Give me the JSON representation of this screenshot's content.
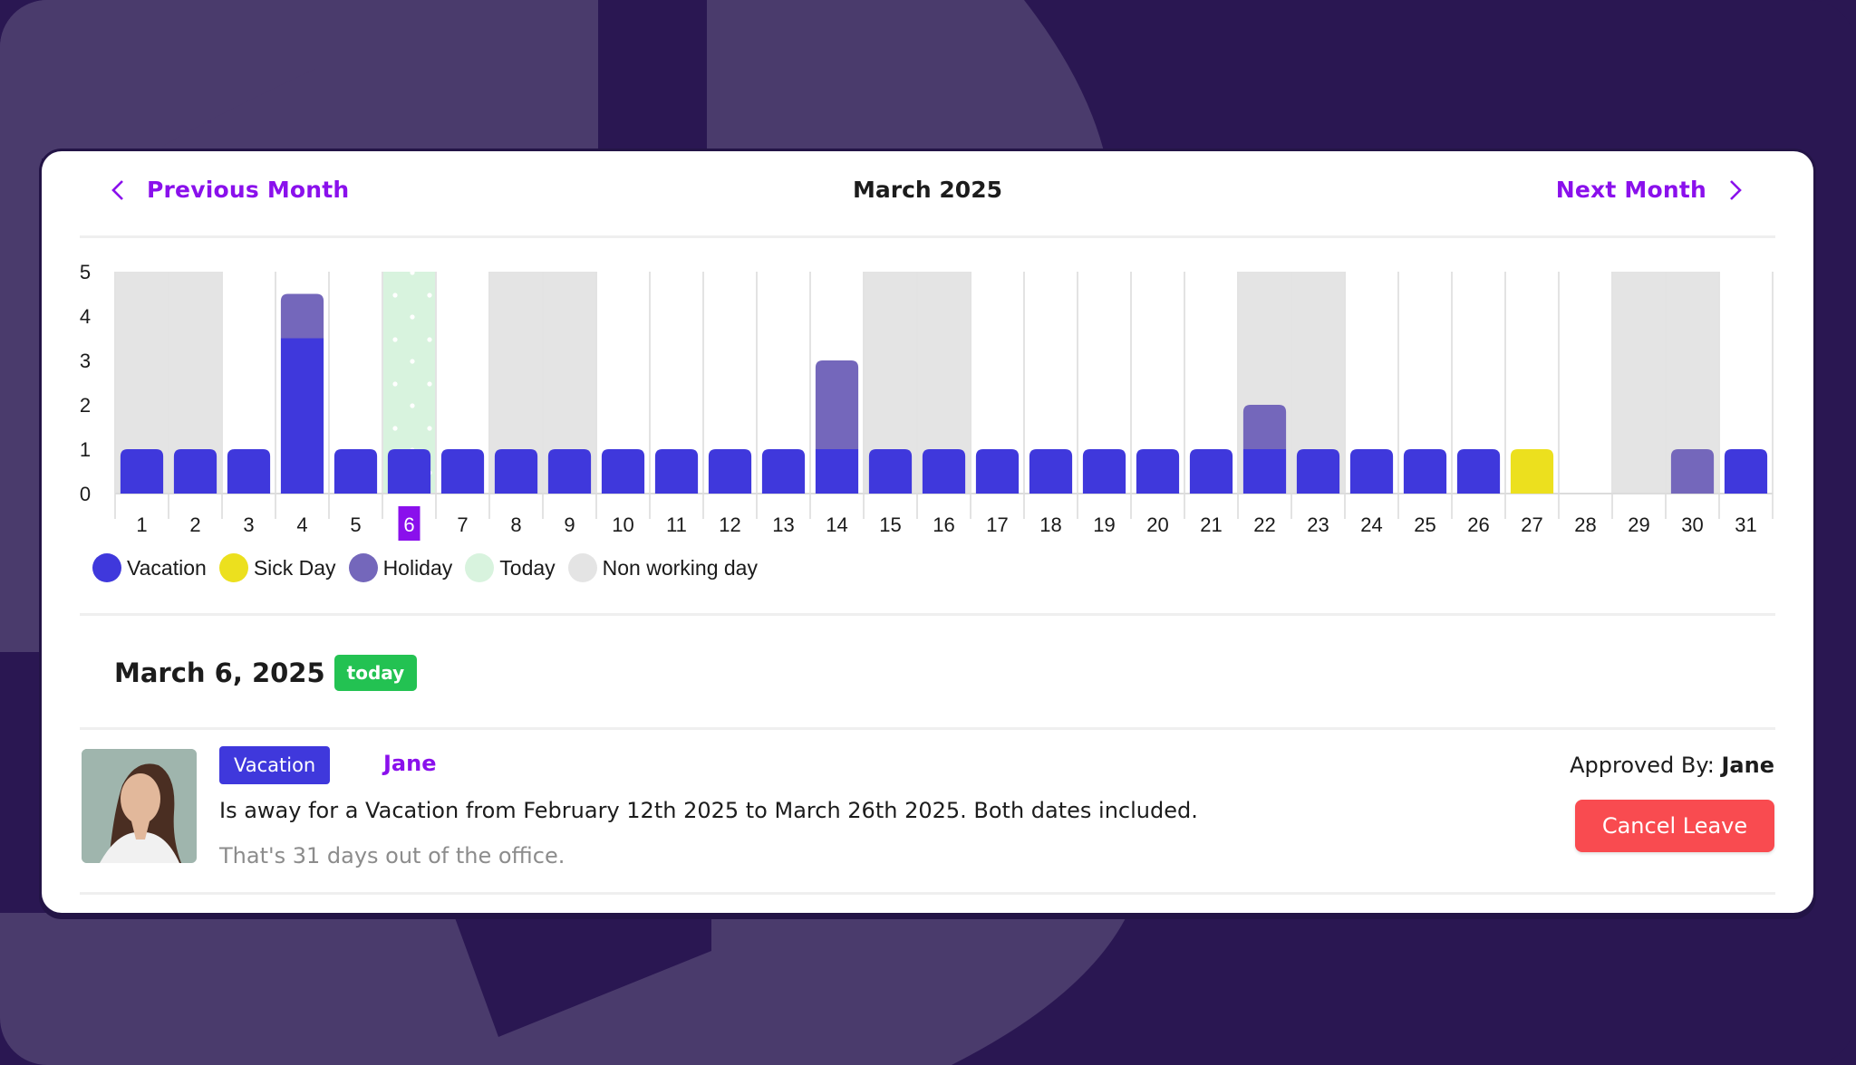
{
  "nav": {
    "prev_label": "Previous Month",
    "next_label": "Next Month",
    "month_title": "March 2025",
    "prev_icon": "chevron-left-icon",
    "next_icon": "chevron-right-icon"
  },
  "colors": {
    "vacation": "#3f38dc",
    "sick_day": "#ece01e",
    "holiday": "#7467bb",
    "today": "#d8f3de",
    "non_working": "#e4e4e4",
    "accent": "#8a10ec",
    "today_badge": "#23c252",
    "cancel": "#f94b50"
  },
  "chart_data": {
    "type": "bar",
    "stacked": true,
    "title": "",
    "xlabel": "",
    "ylabel": "",
    "ylim": [
      0,
      5
    ],
    "yticks": [
      0,
      1,
      2,
      3,
      4,
      5
    ],
    "categories": [
      "1",
      "2",
      "3",
      "4",
      "5",
      "6",
      "7",
      "8",
      "9",
      "10",
      "11",
      "12",
      "13",
      "14",
      "15",
      "16",
      "17",
      "18",
      "19",
      "20",
      "21",
      "22",
      "23",
      "24",
      "25",
      "26",
      "27",
      "28",
      "29",
      "30",
      "31"
    ],
    "series": [
      {
        "name": "Vacation",
        "values": [
          1,
          1,
          1,
          3.5,
          1,
          1,
          1,
          1,
          1,
          1,
          1,
          1,
          1,
          1,
          1,
          1,
          1,
          1,
          1,
          1,
          1,
          1,
          1,
          1,
          1,
          1,
          0,
          0,
          0,
          0,
          1
        ]
      },
      {
        "name": "Sick Day",
        "values": [
          0,
          0,
          0,
          0,
          0,
          0,
          0,
          0,
          0,
          0,
          0,
          0,
          0,
          0,
          0,
          0,
          0,
          0,
          0,
          0,
          0,
          0,
          0,
          0,
          0,
          0,
          1,
          0,
          0,
          0,
          0
        ]
      },
      {
        "name": "Holiday",
        "values": [
          0,
          0,
          0,
          1,
          0,
          0,
          0,
          0,
          0,
          0,
          0,
          0,
          0,
          2,
          0,
          0,
          0,
          0,
          0,
          0,
          0,
          1,
          0,
          0,
          0,
          0,
          0,
          0,
          0,
          1,
          0
        ]
      }
    ],
    "non_working_days": [
      "1",
      "2",
      "8",
      "9",
      "15",
      "16",
      "22",
      "23",
      "29",
      "30"
    ],
    "today": "6",
    "legend": [
      "Vacation",
      "Sick Day",
      "Holiday",
      "Today",
      "Non working day"
    ],
    "legend_position": "bottom-left",
    "grid": true
  },
  "selected_day": {
    "date": "March 6, 2025",
    "badge": "today"
  },
  "leave": {
    "type": "Vacation",
    "employee": "Jane",
    "description": "Is away for a Vacation from February 12th 2025 to March 26th 2025. Both dates included.",
    "summary": "That's 31 days out of the office.",
    "approved_label": "Approved By:",
    "approved_by": "Jane",
    "cancel_label": "Cancel Leave"
  }
}
